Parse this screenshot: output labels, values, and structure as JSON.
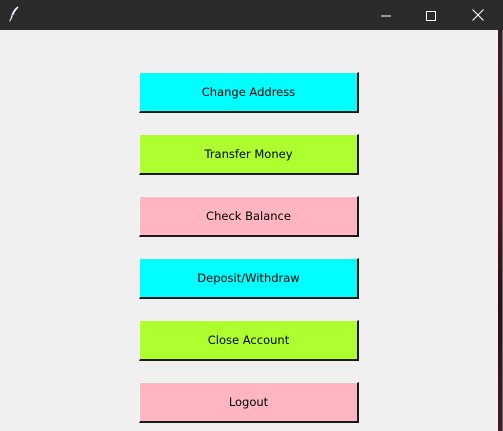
{
  "window": {
    "title": "",
    "icon": "feather-icon",
    "controls": {
      "minimize_icon": "minimize-icon",
      "maximize_icon": "maximize-icon",
      "close_icon": "close-icon"
    }
  },
  "colors": {
    "cyan": "#00ffff",
    "green": "#adff2f",
    "pink": "#ffb6c1",
    "background": "#f0f0f0",
    "titlebar": "#2b2b2b"
  },
  "menu": {
    "buttons": [
      {
        "label": "Change Address",
        "color": "#00ffff"
      },
      {
        "label": "Transfer Money",
        "color": "#adff2f"
      },
      {
        "label": "Check Balance",
        "color": "#ffb6c1"
      },
      {
        "label": "Deposit/Withdraw",
        "color": "#00ffff"
      },
      {
        "label": "Close Account",
        "color": "#adff2f"
      },
      {
        "label": "Logout",
        "color": "#ffb6c1"
      }
    ]
  }
}
